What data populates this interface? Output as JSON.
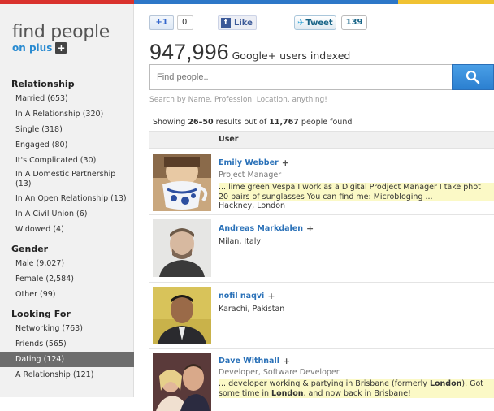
{
  "logo": {
    "title": "find people",
    "subtitle": "on plus",
    "subtitle_icon": "+"
  },
  "sidebar": {
    "groups": [
      {
        "title": "Relationship",
        "items": [
          "Married (653)",
          "In A Relationship (320)",
          "Single (318)",
          "Engaged (80)",
          "It's Complicated (30)",
          "In A Domestic Partnership (13)",
          "In An Open Relationship (13)",
          "In A Civil Union (6)",
          "Widowed (4)"
        ]
      },
      {
        "title": "Gender",
        "items": [
          "Male (9,027)",
          "Female (2,584)",
          "Other (99)"
        ]
      },
      {
        "title": "Looking For",
        "items": [
          "Networking (763)",
          "Friends (565)",
          "Dating (124)",
          "A Relationship (121)"
        ]
      }
    ],
    "active_item": "Dating (124)"
  },
  "social": {
    "gplus_label": "+1",
    "gplus_count": "0",
    "fb_icon": "f",
    "fb_label": "Like",
    "tweet_label": "Tweet",
    "tweet_count": "139"
  },
  "stats": {
    "count": "947,996",
    "label": "Google+ users indexed"
  },
  "search": {
    "placeholder": "Find people..",
    "hint": "Search by Name, Profession, Location, anything!"
  },
  "results": {
    "prefix": "Showing",
    "range": "26–50",
    "middle": "results out of",
    "total": "11,767",
    "suffix": "people found"
  },
  "table": {
    "header": "User"
  },
  "users": [
    {
      "name": "Emily Webber",
      "title": "Project Manager",
      "snippet_lines": [
        "... lime green Vespa I work as a Digital Prodject Manager I take phot",
        "20 pairs of sunglasses You can find me: Microbloging ..."
      ],
      "location": "Hackney, London"
    },
    {
      "name": "Andreas Markdalen",
      "title": "",
      "snippet_lines": [],
      "location": "Milan, Italy"
    },
    {
      "name": "nofil naqvi",
      "title": "",
      "snippet_lines": [],
      "location": "Karachi, Pakistan"
    },
    {
      "name": "Dave Withnall",
      "title": "Developer, Software Developer",
      "snippet_lines": [
        "... developer working & partying in Brisbane (formerly London). Got",
        "some time in London, and now back in Brisbane!"
      ],
      "location": ""
    }
  ],
  "colors": {
    "accent_red": "#d9322d",
    "accent_blue": "#2d77c8",
    "accent_yellow": "#f0c232",
    "link": "#2a71b8",
    "highlight": "#fbf9c6"
  }
}
